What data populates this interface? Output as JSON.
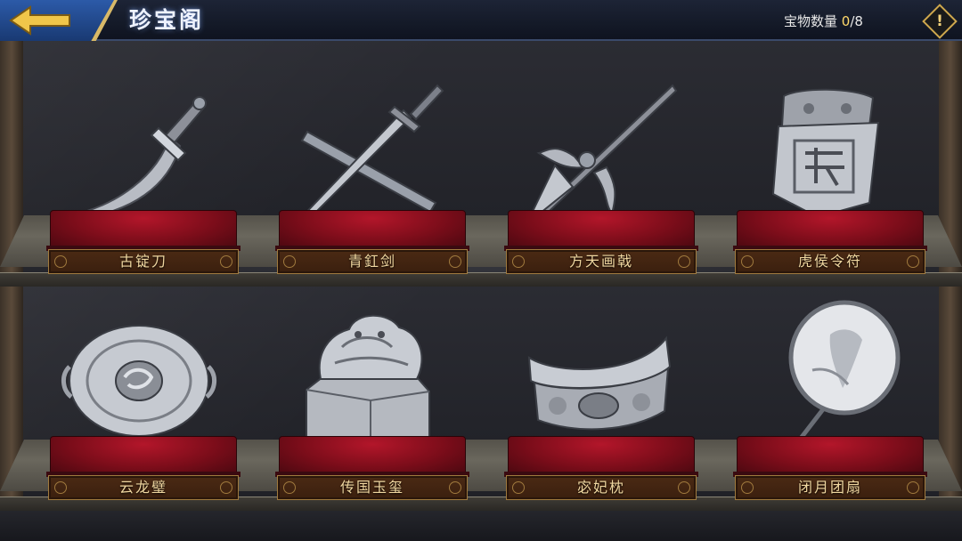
{
  "header": {
    "title": "珍宝阁",
    "count_label": "宝物数量",
    "count_owned": "0",
    "count_separator": "/",
    "count_total": "8",
    "info_glyph": "!"
  },
  "icons": {
    "back": "back-arrow-icon",
    "info": "info-icon"
  },
  "colors": {
    "header_blue": "#2c5aa8",
    "gold_trim": "#d8b968",
    "pedestal_red": "#b3162a",
    "plaque_text": "#f0d7a0",
    "owned_count": "#ffd96a"
  },
  "treasures": [
    {
      "name": "古锭刀",
      "icon": "curved-blade-icon"
    },
    {
      "name": "青釭剑",
      "icon": "crossed-swords-icon"
    },
    {
      "name": "方天画戟",
      "icon": "halberd-icon"
    },
    {
      "name": "虎侯令符",
      "icon": "tiger-token-icon"
    },
    {
      "name": "云龙璧",
      "icon": "dragon-disc-icon"
    },
    {
      "name": "传国玉玺",
      "icon": "imperial-seal-icon"
    },
    {
      "name": "宓妃枕",
      "icon": "pillow-icon"
    },
    {
      "name": "闭月团扇",
      "icon": "round-fan-icon"
    }
  ]
}
